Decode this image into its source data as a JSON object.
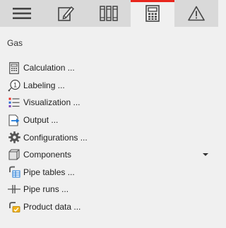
{
  "toolbar": {
    "tabs": [
      {
        "icon": "hamburger-menu-icon",
        "active": false
      },
      {
        "icon": "edit-pencil-icon",
        "active": false
      },
      {
        "icon": "library-books-icon",
        "active": false
      },
      {
        "icon": "calculator-icon",
        "active": true
      },
      {
        "icon": "warning-triangle-icon",
        "active": false
      }
    ],
    "active_accent": "#e8261d"
  },
  "panel": {
    "title": "Gas",
    "items": [
      {
        "label": "Calculation ...",
        "icon": "calculator-icon"
      },
      {
        "label": "Labeling ...",
        "icon": "label-tag-icon"
      },
      {
        "label": "Visualization ...",
        "icon": "color-list-icon"
      },
      {
        "label": "Output ...",
        "icon": "output-arrow-icon"
      },
      {
        "label": "Configurations ...",
        "icon": "gear-icon"
      },
      {
        "label": "Components",
        "icon": "component-cube-icon",
        "has_dropdown": true
      },
      {
        "label": "Pipe tables ...",
        "icon": "pipe-table-icon"
      },
      {
        "label": "Pipe runs ...",
        "icon": "pipe-run-icon"
      },
      {
        "label": "Product data ...",
        "icon": "product-data-icon"
      }
    ]
  }
}
